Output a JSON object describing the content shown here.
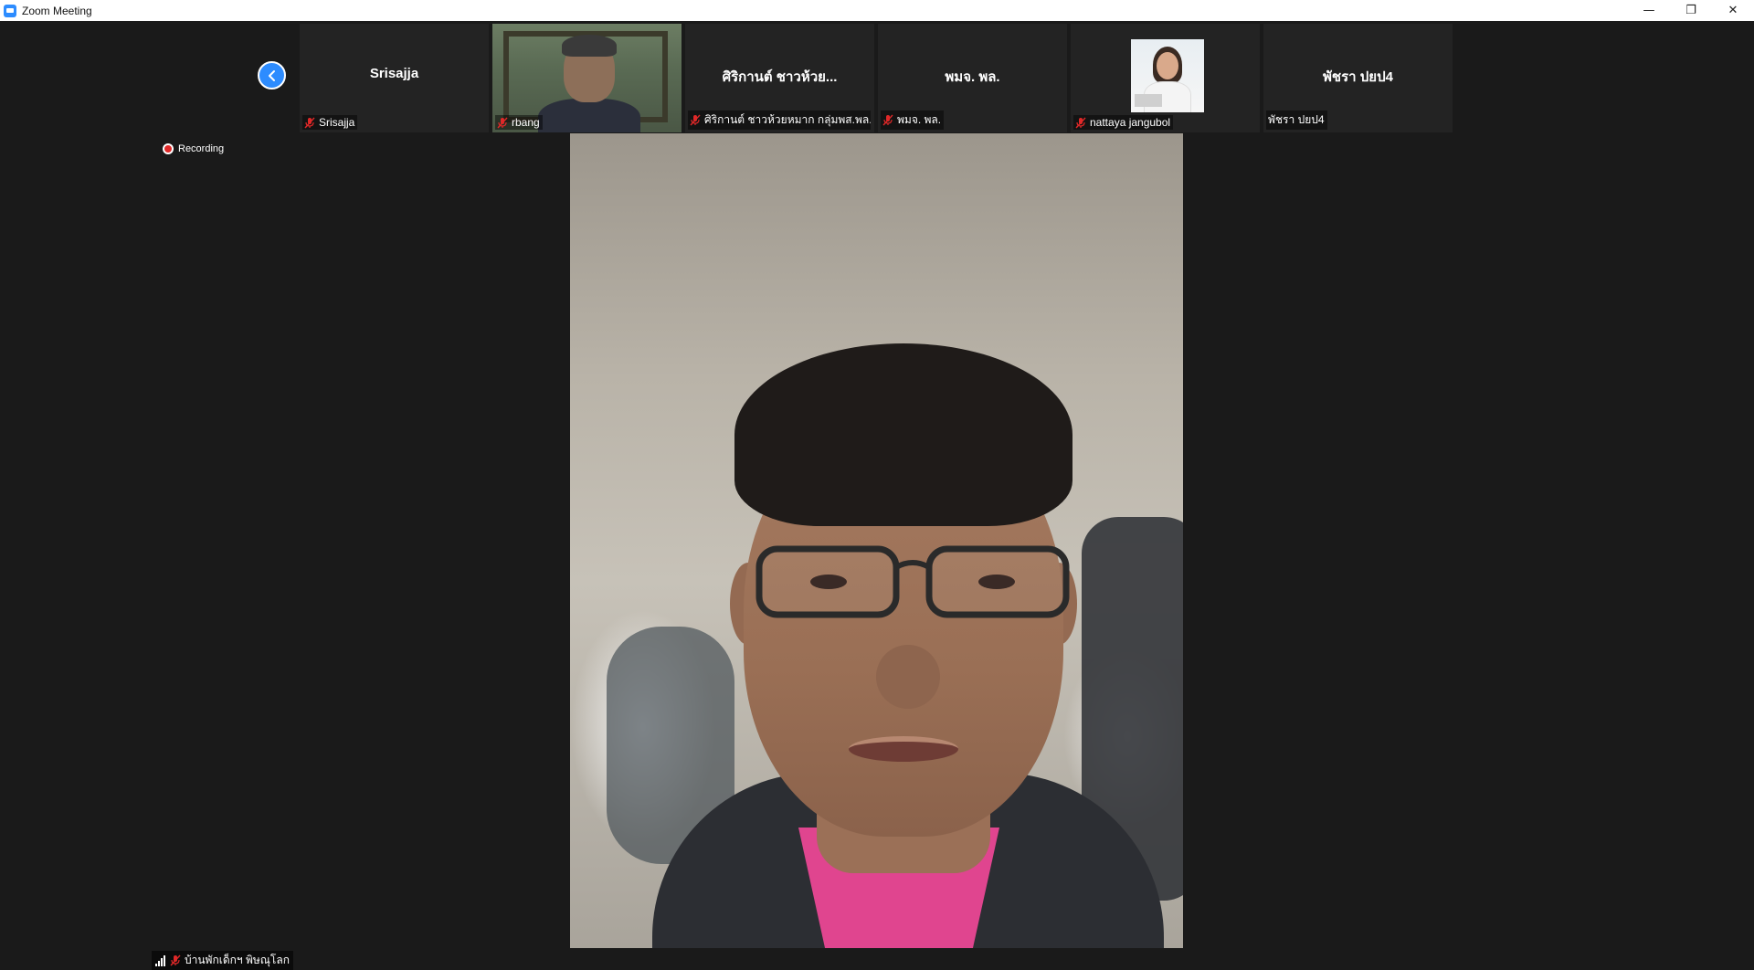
{
  "window": {
    "title": "Zoom Meeting",
    "controls": {
      "minimize": "—",
      "restore": "❐",
      "close": "✕"
    }
  },
  "recording": {
    "label": "Recording"
  },
  "gallery": {
    "prev_icon": "chevron-left-icon",
    "tiles": [
      {
        "title": "Srisajja",
        "label": "Srisajja",
        "muted": true,
        "video": false
      },
      {
        "title": "",
        "label": "rbang",
        "muted": true,
        "video": true
      },
      {
        "title": "ศิริกานต์ ชาวห้วย...",
        "label": "ศิริกานต์ ชาวห้วยหมาก กลุ่มพส.พล.",
        "muted": true,
        "video": false
      },
      {
        "title": "พมจ. พล.",
        "label": "พมจ. พล.",
        "muted": true,
        "video": false
      },
      {
        "title": "",
        "label": "nattaya jangubol",
        "muted": true,
        "video": false,
        "avatar": true
      },
      {
        "title": "พัชรา ปยป4",
        "label": "พัชรา ปยป4",
        "muted": false,
        "video": false
      }
    ]
  },
  "speaker": {
    "label": "บ้านพักเด็กฯ พิษณุโลก",
    "muted": true
  },
  "colors": {
    "accent": "#2d8cff",
    "muted_mic": "#e02828",
    "background": "#1a1a1a"
  }
}
